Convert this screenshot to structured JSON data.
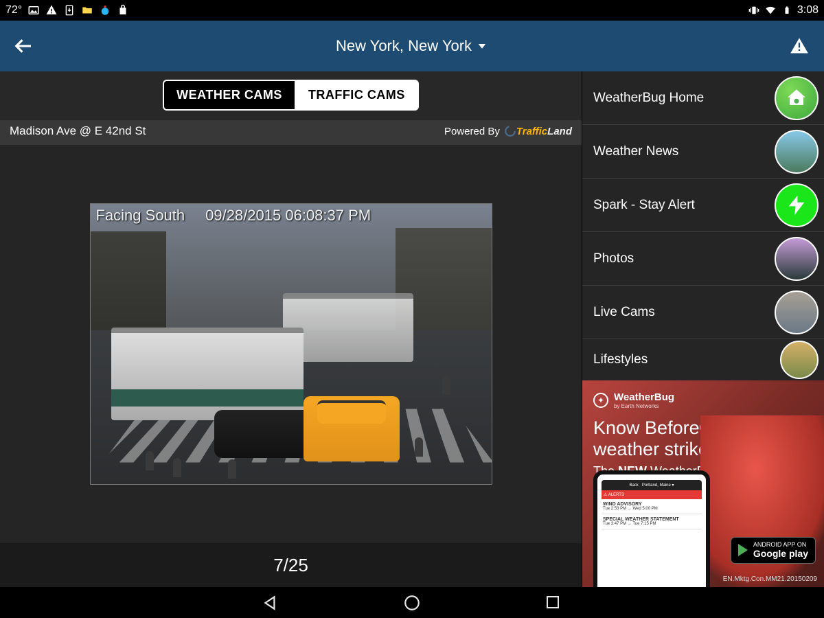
{
  "status_bar": {
    "temperature": "72°",
    "time": "3:08"
  },
  "header": {
    "location": "New York, New York"
  },
  "tabs": {
    "weather": "WEATHER CAMS",
    "traffic": "TRAFFIC CAMS"
  },
  "cam": {
    "location_label": "Madison Ave @ E 42nd St",
    "powered_by_label": "Powered By",
    "provider_traffic": "Traffic",
    "provider_land": "Land",
    "overlay_facing": "Facing South",
    "overlay_timestamp": "09/28/2015 06:08:37 PM",
    "counter": "7/25"
  },
  "sidebar": {
    "items": [
      {
        "label": "WeatherBug Home"
      },
      {
        "label": "Weather News"
      },
      {
        "label": "Spark - Stay Alert"
      },
      {
        "label": "Photos"
      },
      {
        "label": "Live Cams"
      },
      {
        "label": "Lifestyles"
      }
    ]
  },
  "ad": {
    "brand": "WeatherBug",
    "brand_sub": "by Earth Networks",
    "headline": "Know Before® severe weather strikes!",
    "subline": "The NEW WeatherBug app!",
    "phone_header": "Portland, Maine",
    "phone_back": "Back",
    "phone_alerts": "ALERTS",
    "phone_row1_title": "WIND ADVISORY",
    "phone_row1_time": "Tue 2:53 PM → Wed 5:00 PM",
    "phone_row2_title": "SPECIAL WEATHER STATEMENT",
    "phone_row2_time": "Tue 3:47 PM → Tue 7:15 PM",
    "store_small": "ANDROID APP ON",
    "store_big": "Google play",
    "tracking": "EN.Mktg.Con.MM21.20150209"
  }
}
